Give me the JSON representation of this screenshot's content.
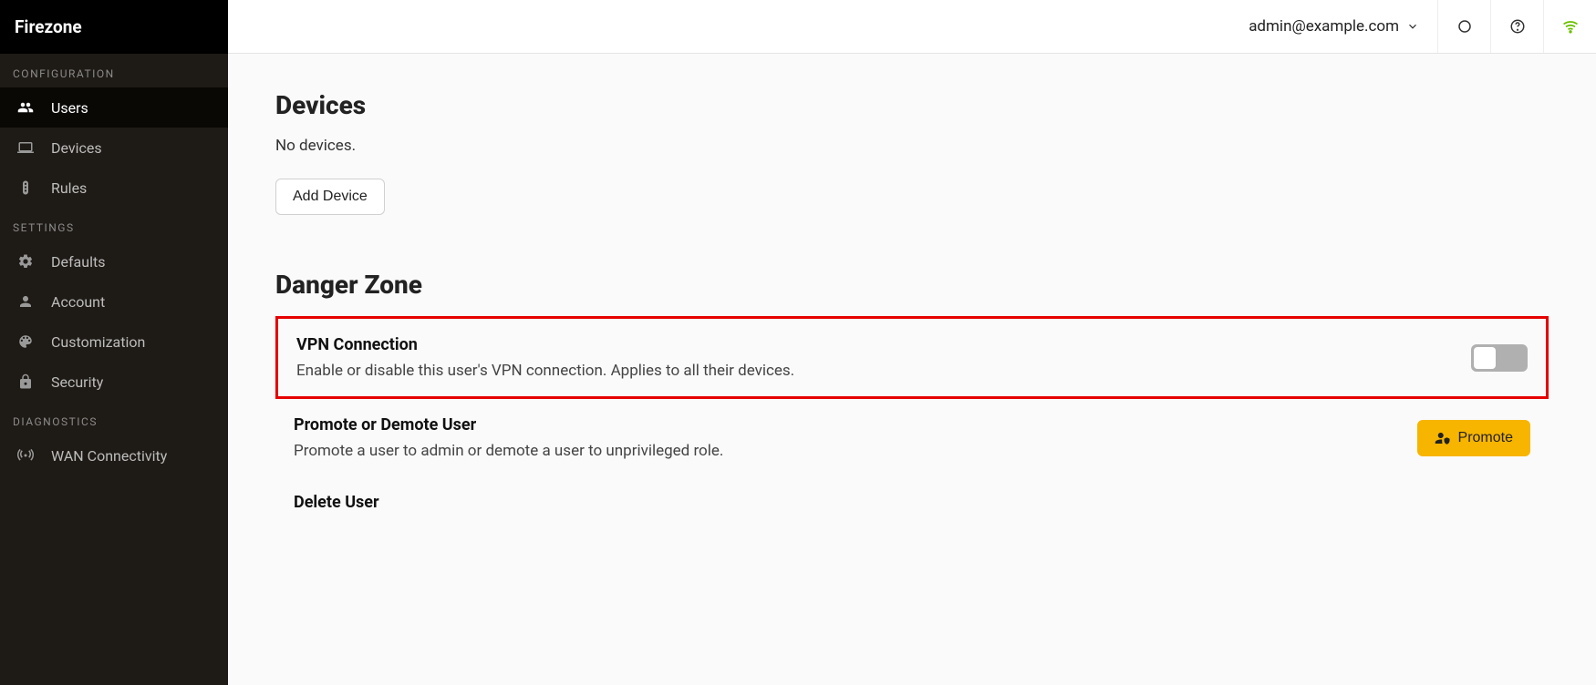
{
  "brand": "Firezone",
  "sidebar": {
    "sections": {
      "configuration": {
        "label": "CONFIGURATION"
      },
      "settings": {
        "label": "SETTINGS"
      },
      "diagnostics": {
        "label": "DIAGNOSTICS"
      }
    },
    "items": {
      "users": "Users",
      "devices": "Devices",
      "rules": "Rules",
      "defaults": "Defaults",
      "account": "Account",
      "customization": "Customization",
      "security": "Security",
      "wan": "WAN Connectivity"
    }
  },
  "topbar": {
    "user_email": "admin@example.com"
  },
  "content": {
    "devices": {
      "heading": "Devices",
      "empty_text": "No devices.",
      "add_button": "Add Device"
    },
    "danger": {
      "heading": "Danger Zone",
      "vpn": {
        "title": "VPN Connection",
        "desc": "Enable or disable this user's VPN connection. Applies to all their devices."
      },
      "promote": {
        "title": "Promote or Demote User",
        "desc": "Promote a user to admin or demote a user to unprivileged role.",
        "button": "Promote"
      },
      "delete": {
        "title": "Delete User"
      }
    }
  }
}
